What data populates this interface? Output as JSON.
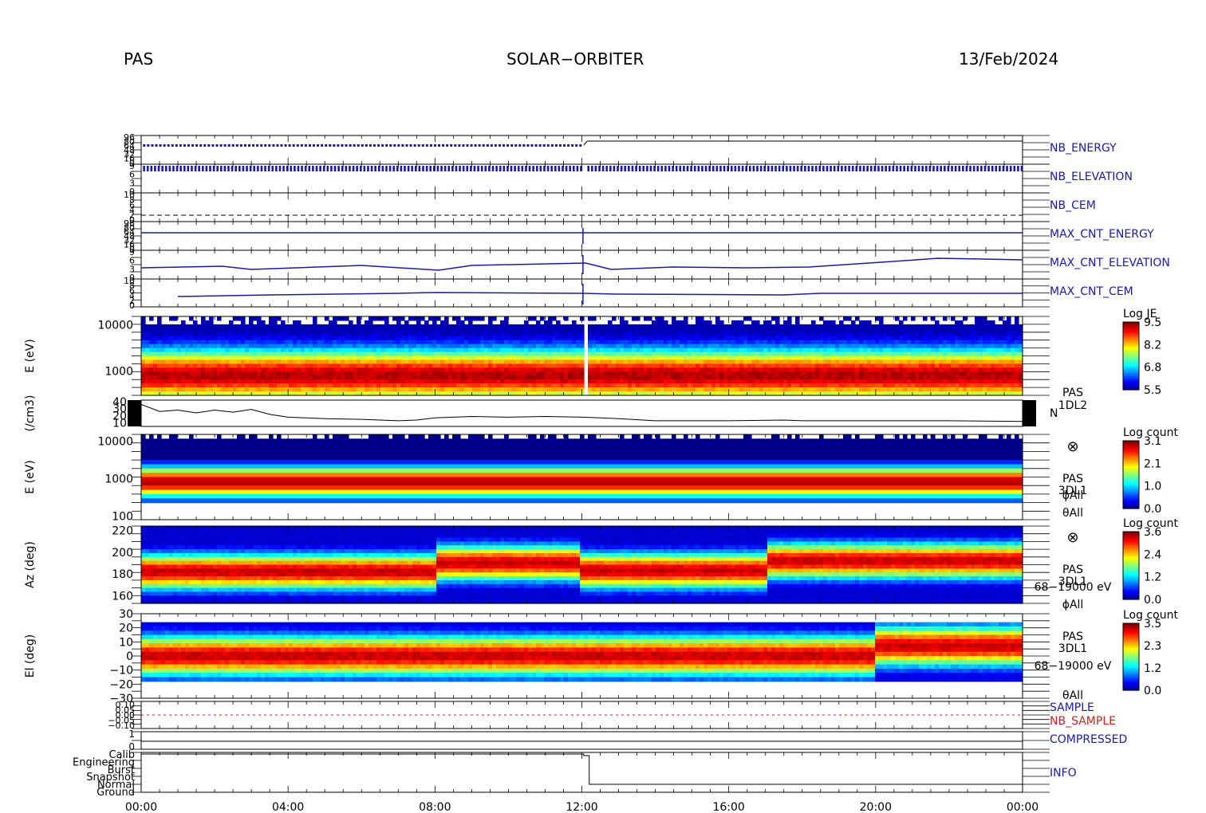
{
  "header": {
    "left": "PAS",
    "center": "SOLAR−ORBITER",
    "right": "13/Feb/2024"
  },
  "colors": {
    "hk_line": "#1a1aa6",
    "nb_sample": "#cc2222",
    "spectrogram_scale": [
      "#00008b",
      "#0000ff",
      "#0080ff",
      "#00ffff",
      "#00ff00",
      "#ffff00",
      "#ff8000",
      "#ff0000",
      "#8b0000"
    ]
  },
  "time_axis": {
    "ticks": [
      "00:00",
      "04:00",
      "08:00",
      "12:00",
      "16:00",
      "20:00",
      "00:00"
    ],
    "range_hours": [
      0,
      24
    ]
  },
  "chart_data": [
    {
      "type": "line",
      "panels": [
        {
          "name": "NB_ENERGY",
          "ticks": [
            "96",
            "80",
            "64",
            "48",
            "32",
            "16",
            "0"
          ]
        },
        {
          "name": "NB_ELEVATION",
          "ticks": [
            "9",
            "6",
            "3",
            "0"
          ]
        },
        {
          "name": "NB_CEM",
          "ticks": [
            "10",
            "8",
            "6",
            "4",
            "2",
            "0"
          ]
        },
        {
          "name": "MAX_CNT_ENERGY",
          "ticks": [
            "96",
            "80",
            "64",
            "48",
            "32",
            "16",
            "0"
          ]
        },
        {
          "name": "MAX_CNT_ELEVATION",
          "ticks": [
            "9",
            "6",
            "3",
            "0"
          ]
        },
        {
          "name": "MAX_CNT_CEM",
          "ticks": [
            "10",
            "8",
            "6",
            "4",
            "2",
            "0"
          ]
        }
      ]
    },
    {
      "type": "heatmap",
      "ylabel": "E (eV)",
      "yticks": [
        "10000",
        "1000"
      ],
      "ylim": [
        300,
        15000
      ],
      "yscale": "log",
      "colorbar": {
        "title": "Log JE",
        "ticks": [
          "9.5",
          "8.2",
          "6.8",
          "5.5"
        ],
        "range": [
          5.5,
          9.5
        ]
      },
      "peak_energy_eV": 800,
      "data_gap_hours": [
        12.05,
        12.15
      ]
    },
    {
      "type": "line",
      "ylabel": "(/cm3)",
      "yticks": [
        "40",
        "30",
        "20",
        "10"
      ],
      "ylim": [
        5,
        42
      ],
      "label": [
        "PAS",
        "1DL2",
        "N"
      ],
      "x": [
        0.0,
        0.5,
        1.0,
        1.5,
        2.0,
        2.5,
        3.0,
        3.5,
        4.0,
        5.0,
        6.0,
        7.0,
        7.5,
        8.0,
        9.0,
        10.0,
        11.0,
        12.0,
        12.5,
        13.0,
        14.0,
        16.0,
        17.5,
        18.0,
        20.0,
        22.0,
        24.0
      ],
      "values": [
        36,
        26,
        28,
        24,
        28,
        25,
        29,
        22,
        18,
        16,
        15,
        13,
        14,
        17,
        19,
        18,
        19,
        18,
        17,
        16,
        13,
        13,
        14,
        13,
        13,
        13,
        12
      ]
    },
    {
      "type": "heatmap",
      "ylabel": "E (eV)",
      "yticks": [
        "10000",
        "1000",
        "100"
      ],
      "ylim": [
        80,
        15000
      ],
      "yscale": "log",
      "colorbar": {
        "title": "Log count",
        "ticks": [
          "3.1",
          "2.1",
          "1.0",
          "0.0"
        ],
        "range": [
          0.0,
          3.1
        ]
      },
      "label": [
        "PAS",
        "3DL1",
        "ϕAll",
        "θAll"
      ],
      "peak_energy_eV": 800
    },
    {
      "type": "heatmap",
      "ylabel": "Az (deg)",
      "yticks": [
        "220",
        "200",
        "180",
        "160"
      ],
      "ylim": [
        153,
        224
      ],
      "colorbar": {
        "title": "Log count",
        "ticks": [
          "3.6",
          "2.4",
          "1.2",
          "0.0"
        ],
        "range": [
          0.0,
          3.6
        ]
      },
      "label": [
        "PAS",
        "3DL1",
        "68−19000 eV",
        "ϕAll"
      ]
    },
    {
      "type": "heatmap",
      "ylabel": "El (deg)",
      "yticks": [
        "30",
        "20",
        "10",
        "0",
        "−10",
        "−20",
        "−30"
      ],
      "ylim": [
        -30,
        30
      ],
      "colorbar": {
        "title": "Log count",
        "ticks": [
          "3.5",
          "2.3",
          "1.2",
          "0.0"
        ],
        "range": [
          0.0,
          3.5
        ]
      },
      "label": [
        "PAS",
        "3DL1",
        "68−19000 eV",
        "θAll"
      ]
    },
    {
      "type": "line",
      "panels": [
        {
          "name": "SAMPLE",
          "ticks": [
            "0.10",
            "0.05",
            "0.00",
            "−0.05",
            "−0.10"
          ]
        },
        {
          "name": "NB_SAMPLE"
        },
        {
          "name": "COMPRESSED",
          "ticks": [
            "1",
            "0"
          ]
        },
        {
          "name": "INFO",
          "ticks": [
            "Calib",
            "Engineering",
            "Burst",
            "Snapshot",
            "Normal",
            "Ground"
          ]
        }
      ]
    }
  ]
}
